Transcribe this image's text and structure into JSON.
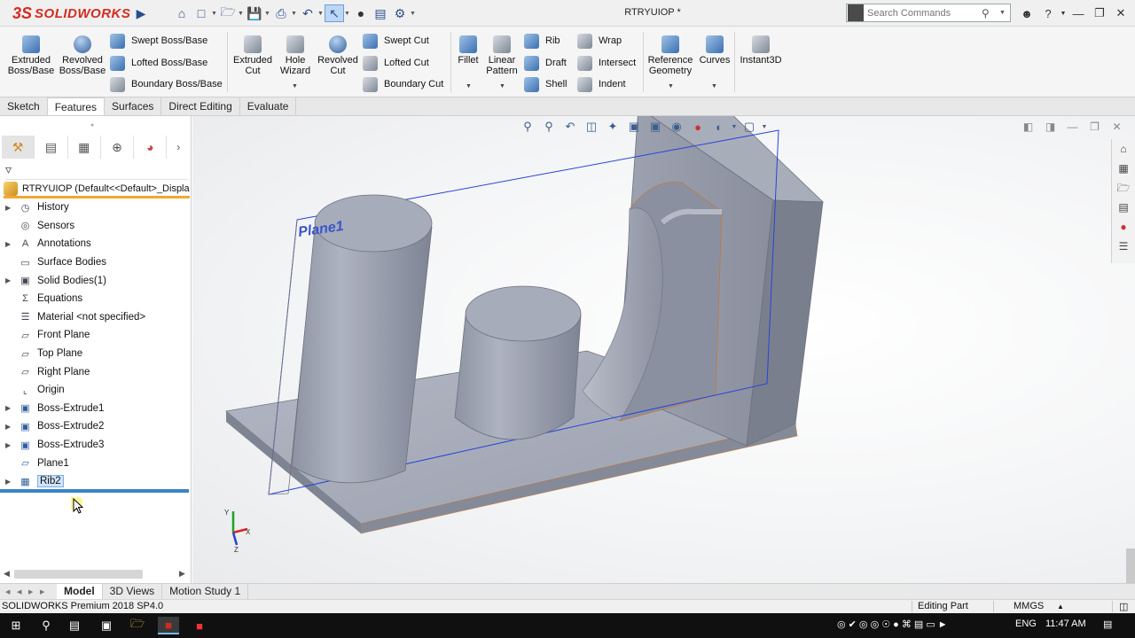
{
  "app": {
    "logo_mark": "3S",
    "logo_text": "SOLIDWORKS",
    "document_title": "RTRYUIOP *"
  },
  "search": {
    "placeholder": "Search Commands"
  },
  "ribbon": {
    "big_buttons": [
      {
        "label1": "Extruded",
        "label2": "Boss/Base"
      },
      {
        "label1": "Revolved",
        "label2": "Boss/Base"
      },
      {
        "label1": "Extruded",
        "label2": "Cut"
      },
      {
        "label1": "Hole",
        "label2": "Wizard"
      },
      {
        "label1": "Revolved",
        "label2": "Cut"
      },
      {
        "label1": "Fillet",
        "label2": ""
      },
      {
        "label1": "Linear",
        "label2": "Pattern"
      },
      {
        "label1": "Reference",
        "label2": "Geometry"
      },
      {
        "label1": "Curves",
        "label2": ""
      },
      {
        "label1": "Instant3D",
        "label2": ""
      }
    ],
    "swept_boss": "Swept Boss/Base",
    "lofted_boss": "Lofted Boss/Base",
    "boundary_boss": "Boundary Boss/Base",
    "swept_cut": "Swept Cut",
    "lofted_cut": "Lofted Cut",
    "boundary_cut": "Boundary Cut",
    "rib": "Rib",
    "draft": "Draft",
    "shell": "Shell",
    "wrap": "Wrap",
    "intersect": "Intersect",
    "indent": "Indent"
  },
  "command_tabs": [
    "Sketch",
    "Features",
    "Surfaces",
    "Direct Editing",
    "Evaluate"
  ],
  "active_command_tab": "Features",
  "feature_tree": {
    "root": "RTRYUIOP  (Default<<Default>_Displa",
    "items": [
      {
        "label": "History",
        "icon": "history-icon",
        "expandable": true
      },
      {
        "label": "Sensors",
        "icon": "sensors-icon",
        "expandable": false
      },
      {
        "label": "Annotations",
        "icon": "annotations-icon",
        "expandable": true
      },
      {
        "label": "Surface Bodies",
        "icon": "surface-bodies-icon",
        "expandable": false
      },
      {
        "label": "Solid Bodies(1)",
        "icon": "solid-bodies-icon",
        "expandable": true
      },
      {
        "label": "Equations",
        "icon": "equations-icon",
        "expandable": false
      },
      {
        "label": "Material <not specified>",
        "icon": "material-icon",
        "expandable": false
      },
      {
        "label": "Front Plane",
        "icon": "plane-icon",
        "expandable": false
      },
      {
        "label": "Top Plane",
        "icon": "plane-icon",
        "expandable": false
      },
      {
        "label": "Right Plane",
        "icon": "plane-icon",
        "expandable": false
      },
      {
        "label": "Origin",
        "icon": "origin-icon",
        "expandable": false
      },
      {
        "label": "Boss-Extrude1",
        "icon": "extrude-icon",
        "expandable": true
      },
      {
        "label": "Boss-Extrude2",
        "icon": "extrude-icon",
        "expandable": true
      },
      {
        "label": "Boss-Extrude3",
        "icon": "extrude-icon",
        "expandable": true
      },
      {
        "label": "Plane1",
        "icon": "plane-icon",
        "expandable": false
      },
      {
        "label": "Rib2",
        "icon": "rib-icon",
        "expandable": true,
        "selected": true
      }
    ]
  },
  "viewport": {
    "plane_label": "Plane1",
    "triad_x": "X",
    "triad_y": "Y",
    "triad_z": "Z"
  },
  "bottom_tabs": [
    "Model",
    "3D Views",
    "Motion Study 1"
  ],
  "active_bottom_tab": "Model",
  "status": {
    "product": "SOLIDWORKS Premium 2018 SP4.0",
    "mode": "Editing Part",
    "units": "MMGS"
  },
  "taskbar": {
    "language": "ENG",
    "time": "11:47 AM"
  },
  "colors": {
    "accent": "#d52b1e",
    "selection": "#cfe3fb",
    "rollback_bar": "#3a84c8",
    "tree_root_underline": "#f0a830",
    "model_face": "#a3a8b6"
  }
}
